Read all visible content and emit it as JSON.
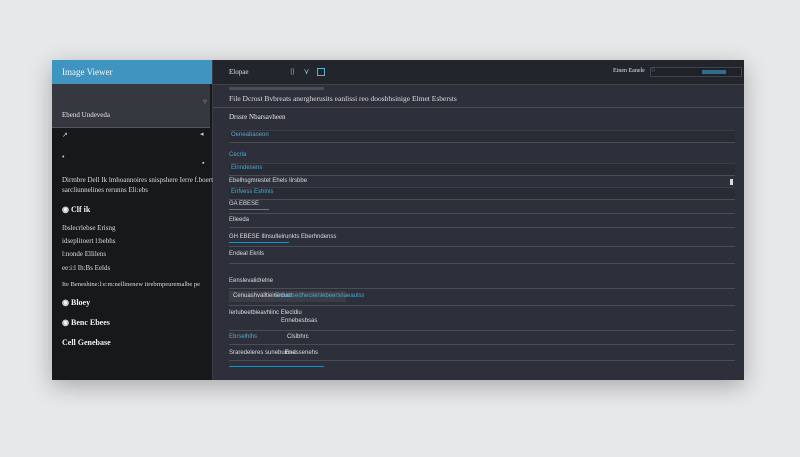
{
  "window": {
    "title": "Image Viewer"
  },
  "sidebar": {
    "header_label": "Ebend Undeveda",
    "lines": [
      "Dirmbre Dell Ik lmhoannoires snispshere Ierre f.boert",
      "sarcliunnelines rerunns Eli:ebs",
      "Clf ik",
      "Ibslecrlebse Erisng",
      "idseplitoert l:bebhs",
      "l:nonde Ellilens",
      "ee:i:l Ih:Bs Eelds",
      "Ite Beneshine:l:e:m:nellinenew itrebrnpeuremalbe pe",
      "Bloey",
      "Benc Ebees",
      "Cell Genebase"
    ]
  },
  "toolbar": {
    "label": "Elopae",
    "right_label": "Einen Eanele"
  },
  "menubar": {
    "text": "File Dcrost  Bvbreats anergherusits eanlissi reo doosbhsinige Elmet Esbersts"
  },
  "content": {
    "section_title": "Drssre Nbarsavheen",
    "fields": [
      {
        "label": "",
        "value": "Oeneabaseon"
      },
      {
        "label": "Cecrla",
        "value": "Elnndesens"
      },
      {
        "label": "Ebelhsgmrestet Ehels Ilrsbbe",
        "value": "Enfvess Eshlnis"
      },
      {
        "label": "GA EBESE",
        "value": ""
      },
      {
        "label": "Elleeda",
        "value": ""
      },
      {
        "label": "GH EBESE Illnsulteirunkts Eberhndenss",
        "value": ""
      },
      {
        "label": "Endeal Ekrils",
        "value": ""
      },
      {
        "label": "Eenslevalidrelne",
        "value": ""
      },
      {
        "label": "Cenuashvalltieineduet",
        "value": "Enbessedhecleinlebeersnaeaulss"
      },
      {
        "label": "Ierlubeetbieavhlinc Elecldiu",
        "value": "Ennebesbsas"
      },
      {
        "label": "Ebrselhlhs",
        "value": "Clslbhrc"
      },
      {
        "label": "Sraredeleres sunebuinsd",
        "value": "Enessenehs"
      }
    ]
  },
  "colors": {
    "accent": "#3f94c0",
    "link": "#53a8cc",
    "panel": "#2d2f3a",
    "sidebar": "#171819"
  },
  "icons": [
    "chevron-icon",
    "arrow-icon",
    "cursor-icon",
    "filter-icon",
    "pin-icon",
    "frame-icon",
    "search-icon",
    "radio-icon"
  ]
}
